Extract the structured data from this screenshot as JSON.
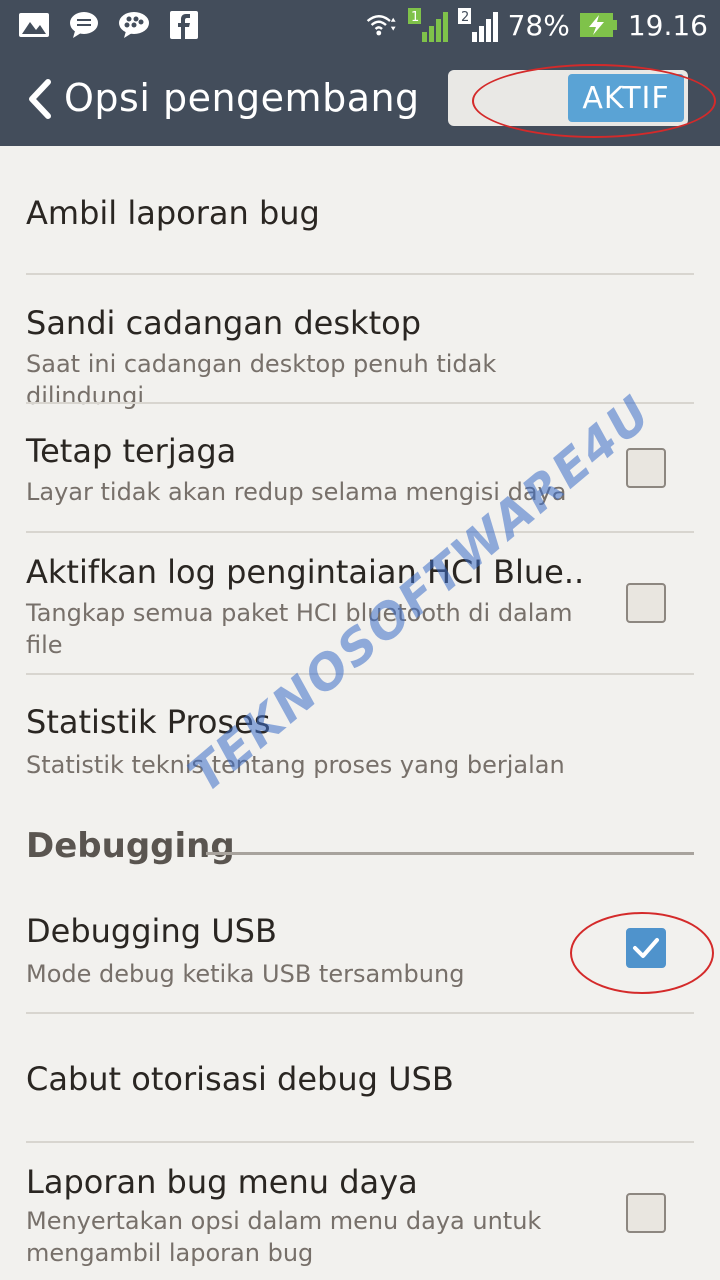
{
  "status_bar": {
    "battery": "78%",
    "time": "19.16",
    "sim1": "1",
    "sim2": "2",
    "left_icons": [
      "gallery-icon",
      "message-icon",
      "bbm-icon",
      "facebook-icon"
    ]
  },
  "action_bar": {
    "title": "Opsi pengembang",
    "toggle_label": "AKTIF",
    "toggle_on": true
  },
  "items": [
    {
      "title": "Ambil laporan bug",
      "subtitle": ""
    },
    {
      "title": "Sandi cadangan desktop",
      "subtitle": "Saat ini cadangan desktop penuh tidak dilindungi"
    },
    {
      "title": "Tetap terjaga",
      "subtitle": "Layar tidak akan redup selama mengisi daya",
      "checked": false
    },
    {
      "title": "Aktifkan log pengintaian HCI Blue..",
      "subtitle": "Tangkap semua paket HCI bluetooth di dalam file",
      "checked": false
    },
    {
      "title": "Statistik Proses",
      "subtitle": "Statistik teknis tentang proses yang berjalan"
    }
  ],
  "section": {
    "title": "Debugging"
  },
  "debug_items": [
    {
      "title": "Debugging USB",
      "subtitle": "Mode debug ketika USB tersambung",
      "checked": true
    },
    {
      "title": "Cabut otorisasi debug USB",
      "subtitle": ""
    },
    {
      "title": "Laporan bug menu daya",
      "subtitle": "Menyertakan opsi dalam menu daya untuk mengambil laporan bug",
      "checked": false
    }
  ],
  "watermark": "TEKNOSOFTWARE4U",
  "colors": {
    "bar": "#434d5b",
    "accent": "#5aa3d5",
    "highlight": "#d42a2a"
  }
}
